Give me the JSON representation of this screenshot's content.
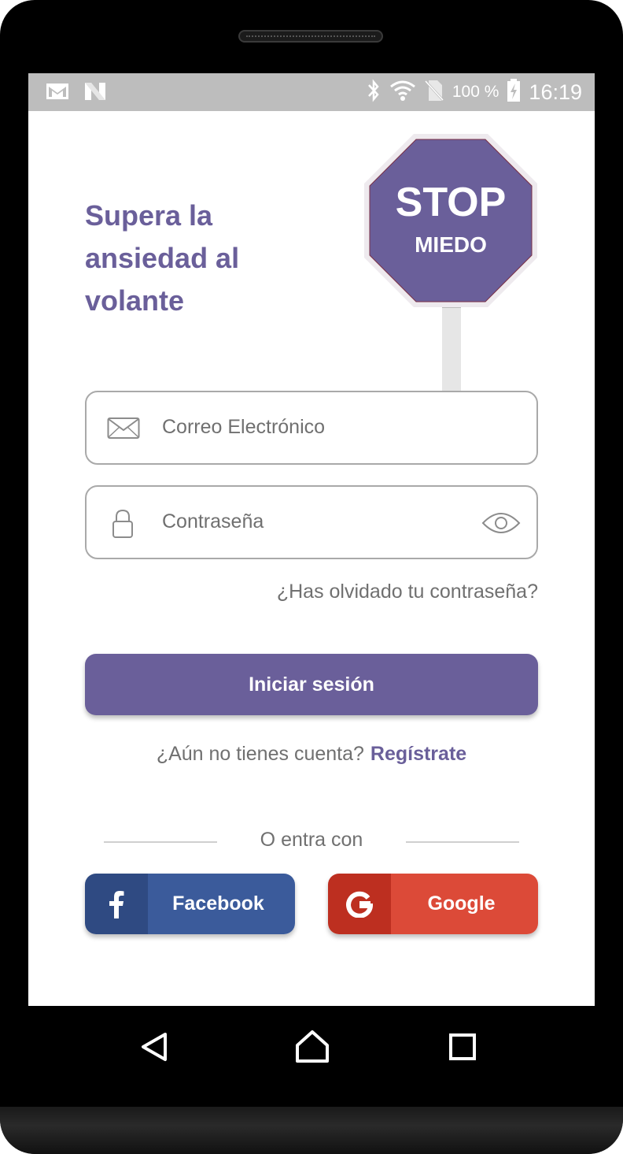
{
  "status_bar": {
    "left_icons": [
      "gmail-icon",
      "n-notification-icon"
    ],
    "right_icons": [
      "bluetooth-icon",
      "wifi-icon",
      "no-sim-icon",
      "battery-charging-icon"
    ],
    "battery_percent": "100 %",
    "time": "16:19"
  },
  "hero": {
    "headline": "Supera la ansiedad al volante",
    "sign_line1": "STOP",
    "sign_line2": "MIEDO"
  },
  "form": {
    "email_placeholder": "Correo Electrónico",
    "password_placeholder": "Contraseña",
    "forgot_password": "¿Has olvidado tu contraseña?",
    "login_button": "Iniciar sesión"
  },
  "signup": {
    "prompt": "¿Aún no tienes cuenta?",
    "link": "Regístrate"
  },
  "social": {
    "divider_label": "O entra con",
    "facebook_label": "Facebook",
    "google_label": "Google"
  },
  "colors": {
    "accent": "#6a5f9a",
    "facebook": "#3b5b9b",
    "google": "#dc4a38",
    "status_bar": "#bdbdbd"
  },
  "nav_bar": {
    "icons": [
      "back-icon",
      "home-icon",
      "recents-icon"
    ]
  }
}
